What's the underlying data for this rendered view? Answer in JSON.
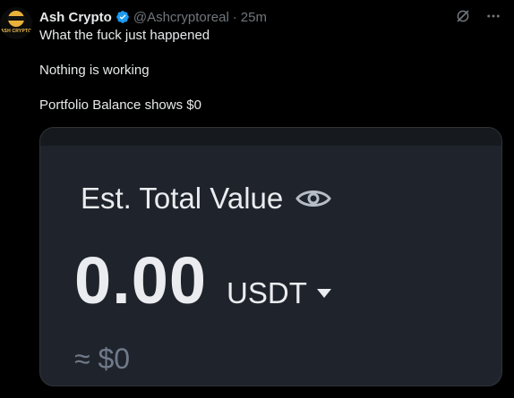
{
  "tweet": {
    "author_name": "Ash Crypto",
    "handle": "@Ashcryptoreal",
    "separator": "·",
    "time": "25m",
    "avatar_text": "ASH CRYPTO",
    "lines": [
      "What the fuck just happened",
      "Nothing is working",
      "Portfolio Balance shows $0"
    ]
  },
  "icons": {
    "verified": "verified-badge-icon",
    "grok": "grok-icon",
    "more": "more-icon",
    "eye": "eye-icon",
    "caret": "caret-down-icon"
  },
  "media": {
    "label": "Est. Total Value",
    "amount": "0.00",
    "currency": "USDT",
    "approx": "≈ $0"
  },
  "colors": {
    "background": "#000000",
    "verified": "#1d9bf0",
    "card": "#1f242c",
    "muted": "#71767b"
  }
}
